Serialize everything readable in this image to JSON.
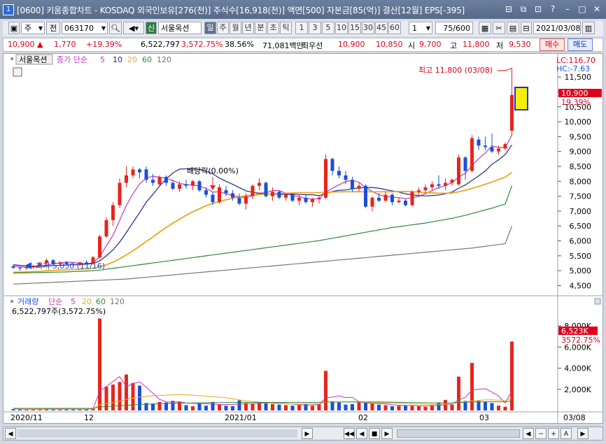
{
  "window": {
    "title": "[0600] 키움종합차트 - KOSDAQ 외국인보유[276(천)] 주식수[16,918(천)] 액면[500] 자본금[85(억)] 결산[12월] EPS[-395]",
    "app_icon": "1",
    "buttons": [
      "restore-icon",
      "duplicate-icon",
      "lock-icon",
      "help-icon",
      "minimize-icon",
      "maximize-icon",
      "close-icon"
    ]
  },
  "toolbar": {
    "market": "주",
    "prev_label": "전",
    "stock_code": "063170",
    "stock_name": "서울옥션",
    "sin_label": "신",
    "periods": [
      "일",
      "주",
      "월",
      "년",
      "분",
      "초",
      "틱"
    ],
    "active_period": "일",
    "minutes": [
      "1",
      "3",
      "5",
      "10",
      "15",
      "30",
      "45",
      "60"
    ],
    "step_value": "1",
    "count": "75/600",
    "date": "2021/03/08"
  },
  "quote": {
    "price": "10,900",
    "change_arrow": "▲",
    "change": "1,770",
    "change_pct": "+19.39%",
    "volume": "6,522,797",
    "volume_pct": "3,572.75%",
    "turnover_pct": "38.56%",
    "amount": "71,081백만",
    "best_label": "최우선",
    "ask": "10,900",
    "bid": "10,850",
    "open_label": "시",
    "open": "9,700",
    "high_label": "고",
    "high": "11,800",
    "low_label": "저",
    "low": "9,530",
    "buy_label": "매수",
    "sell_label": "매도"
  },
  "price_panel": {
    "stock_label": "서울옥션",
    "ma_label": "종가 단순",
    "ma_periods": [
      "5",
      "10",
      "20",
      "60",
      "120"
    ],
    "lc_label": "LC:116.70",
    "hc_label": "HC:-7.63",
    "last_price_label": "10,900",
    "last_pct_label": "19.39%",
    "high_annotation": "최고 11,800 (03/08)",
    "low_annotation": "최저 5,030 (11/16)",
    "dividend_annotation": "배당락(0.00%)"
  },
  "volume_panel": {
    "label": "거래량",
    "ma_label": "단순",
    "ma_periods": [
      "5",
      "20",
      "60",
      "120"
    ],
    "value_text": "6,522,797주(3,572.75%)",
    "last_label": "6,523K",
    "last_pct": "3572.75%"
  },
  "x_axis": {
    "labels": [
      "2020/11",
      "12",
      "2021/01",
      "02",
      "03"
    ],
    "right_label": "03/08"
  },
  "colors": {
    "up": "#e8251b",
    "down": "#1a4fd8",
    "ma5": "#c436c4",
    "ma10": "#1d2a8a",
    "ma20": "#f0a51c",
    "ma60": "#2a8a3a",
    "ma120": "#777777"
  },
  "chart_data": {
    "type": "candlestick",
    "y_ticks": [
      4500,
      5000,
      5500,
      6000,
      6500,
      7000,
      7500,
      8000,
      8500,
      9000,
      9500,
      10000,
      10500,
      11000,
      11500
    ],
    "volume_ticks": [
      "2,000K",
      "4,000K",
      "6,000K",
      "8,000K"
    ],
    "candles": [
      {
        "o": 5150,
        "h": 5200,
        "l": 5050,
        "c": 5100
      },
      {
        "o": 5100,
        "h": 5150,
        "l": 5000,
        "c": 5080
      },
      {
        "o": 5080,
        "h": 5150,
        "l": 5030,
        "c": 5120
      },
      {
        "o": 5120,
        "h": 5200,
        "l": 5070,
        "c": 5160
      },
      {
        "o": 5160,
        "h": 5300,
        "l": 5100,
        "c": 5250
      },
      {
        "o": 5250,
        "h": 5400,
        "l": 5200,
        "c": 5350
      },
      {
        "o": 5350,
        "h": 5400,
        "l": 5200,
        "c": 5230
      },
      {
        "o": 5230,
        "h": 5320,
        "l": 5180,
        "c": 5280
      },
      {
        "o": 5280,
        "h": 5320,
        "l": 5180,
        "c": 5220
      },
      {
        "o": 5220,
        "h": 5280,
        "l": 5150,
        "c": 5200
      },
      {
        "o": 5200,
        "h": 5300,
        "l": 5150,
        "c": 5280
      },
      {
        "o": 5280,
        "h": 5350,
        "l": 5200,
        "c": 5250
      },
      {
        "o": 5250,
        "h": 5500,
        "l": 5200,
        "c": 5450
      },
      {
        "o": 5450,
        "h": 6200,
        "l": 5400,
        "c": 6150
      },
      {
        "o": 6150,
        "h": 6800,
        "l": 6100,
        "c": 6700
      },
      {
        "o": 6700,
        "h": 7300,
        "l": 6500,
        "c": 7200
      },
      {
        "o": 7200,
        "h": 8100,
        "l": 7100,
        "c": 7950
      },
      {
        "o": 7950,
        "h": 8500,
        "l": 7800,
        "c": 8200
      },
      {
        "o": 8200,
        "h": 8500,
        "l": 8100,
        "c": 8400
      },
      {
        "o": 8400,
        "h": 8450,
        "l": 8100,
        "c": 8300
      },
      {
        "o": 8400,
        "h": 8500,
        "l": 7950,
        "c": 8050
      },
      {
        "o": 8050,
        "h": 8250,
        "l": 7850,
        "c": 7950
      },
      {
        "o": 7900,
        "h": 8200,
        "l": 7850,
        "c": 8150
      },
      {
        "o": 8150,
        "h": 8200,
        "l": 7850,
        "c": 7950
      },
      {
        "o": 7950,
        "h": 8050,
        "l": 7700,
        "c": 7750
      },
      {
        "o": 7750,
        "h": 8000,
        "l": 7650,
        "c": 7900
      },
      {
        "o": 7900,
        "h": 8050,
        "l": 7750,
        "c": 7850
      },
      {
        "o": 7850,
        "h": 8050,
        "l": 7700,
        "c": 8000
      },
      {
        "o": 8000,
        "h": 8050,
        "l": 7650,
        "c": 7700
      },
      {
        "o": 7700,
        "h": 7800,
        "l": 7450,
        "c": 7550
      },
      {
        "o": 7550,
        "h": 7650,
        "l": 7200,
        "c": 7300
      },
      {
        "o": 7300,
        "h": 7900,
        "l": 7250,
        "c": 7800
      },
      {
        "o": 7700,
        "h": 7850,
        "l": 7500,
        "c": 7600
      },
      {
        "o": 7600,
        "h": 7700,
        "l": 7350,
        "c": 7450
      },
      {
        "o": 7450,
        "h": 7600,
        "l": 7200,
        "c": 7250
      },
      {
        "o": 7250,
        "h": 7600,
        "l": 7050,
        "c": 7500
      },
      {
        "o": 7500,
        "h": 7900,
        "l": 7400,
        "c": 7850
      },
      {
        "o": 7850,
        "h": 8100,
        "l": 7700,
        "c": 7950
      },
      {
        "o": 7950,
        "h": 8000,
        "l": 7450,
        "c": 7500
      },
      {
        "o": 7500,
        "h": 7800,
        "l": 7350,
        "c": 7650
      },
      {
        "o": 7650,
        "h": 7700,
        "l": 7400,
        "c": 7450
      },
      {
        "o": 7450,
        "h": 7600,
        "l": 7350,
        "c": 7550
      },
      {
        "o": 7550,
        "h": 7600,
        "l": 7300,
        "c": 7350
      },
      {
        "o": 7350,
        "h": 7550,
        "l": 7200,
        "c": 7450
      },
      {
        "o": 7450,
        "h": 7550,
        "l": 7250,
        "c": 7300
      },
      {
        "o": 7300,
        "h": 7450,
        "l": 7150,
        "c": 7400
      },
      {
        "o": 7400,
        "h": 7500,
        "l": 7250,
        "c": 7450
      },
      {
        "o": 7450,
        "h": 8900,
        "l": 7400,
        "c": 8750
      },
      {
        "o": 8750,
        "h": 8800,
        "l": 8200,
        "c": 8350
      },
      {
        "o": 8350,
        "h": 8500,
        "l": 8100,
        "c": 8200
      },
      {
        "o": 8200,
        "h": 8350,
        "l": 7900,
        "c": 8050
      },
      {
        "o": 8050,
        "h": 8150,
        "l": 7650,
        "c": 7750
      },
      {
        "o": 7750,
        "h": 7950,
        "l": 7650,
        "c": 7850
      },
      {
        "o": 7850,
        "h": 7900,
        "l": 7100,
        "c": 7150
      },
      {
        "o": 7150,
        "h": 7500,
        "l": 7000,
        "c": 7450
      },
      {
        "o": 7450,
        "h": 7600,
        "l": 7300,
        "c": 7350
      },
      {
        "o": 7350,
        "h": 7650,
        "l": 7300,
        "c": 7550
      },
      {
        "o": 7550,
        "h": 7600,
        "l": 7200,
        "c": 7300
      },
      {
        "o": 7300,
        "h": 7450,
        "l": 7250,
        "c": 7350
      },
      {
        "o": 7350,
        "h": 7400,
        "l": 7150,
        "c": 7200
      },
      {
        "o": 7200,
        "h": 7700,
        "l": 7150,
        "c": 7650
      },
      {
        "o": 7650,
        "h": 7800,
        "l": 7550,
        "c": 7700
      },
      {
        "o": 7700,
        "h": 7900,
        "l": 7600,
        "c": 7800
      },
      {
        "o": 7800,
        "h": 8000,
        "l": 7700,
        "c": 7900
      },
      {
        "o": 7900,
        "h": 8200,
        "l": 7750,
        "c": 7850
      },
      {
        "o": 7850,
        "h": 8100,
        "l": 7700,
        "c": 7950
      },
      {
        "o": 7950,
        "h": 8100,
        "l": 7850,
        "c": 8050
      },
      {
        "o": 7900,
        "h": 8900,
        "l": 7850,
        "c": 8800
      },
      {
        "o": 8800,
        "h": 8850,
        "l": 8050,
        "c": 8350
      },
      {
        "o": 8350,
        "h": 9550,
        "l": 8300,
        "c": 9450
      },
      {
        "o": 9400,
        "h": 9500,
        "l": 9050,
        "c": 9200
      },
      {
        "o": 9200,
        "h": 9500,
        "l": 9050,
        "c": 9150
      },
      {
        "o": 9150,
        "h": 9600,
        "l": 8950,
        "c": 9000
      },
      {
        "o": 9000,
        "h": 9200,
        "l": 8900,
        "c": 9100
      },
      {
        "o": 9100,
        "h": 9300,
        "l": 9050,
        "c": 9250
      },
      {
        "o": 9700,
        "h": 11800,
        "l": 9530,
        "c": 10900
      }
    ],
    "volumes": [
      130,
      110,
      95,
      100,
      120,
      150,
      140,
      105,
      110,
      100,
      95,
      130,
      150,
      8700,
      2250,
      2450,
      2700,
      3400,
      2600,
      2350,
      700,
      650,
      800,
      750,
      900,
      850,
      500,
      400,
      650,
      450,
      800,
      600,
      450,
      400,
      950,
      700,
      650,
      800,
      750,
      600,
      550,
      500,
      450,
      500,
      600,
      450,
      600,
      3750,
      850,
      750,
      550,
      600,
      800,
      700,
      650,
      550,
      500,
      400,
      450,
      500,
      450,
      400,
      350,
      500,
      700,
      1000,
      550,
      3200,
      900,
      4500,
      900,
      800,
      700,
      450,
      350,
      6523
    ],
    "ma_values": {
      "ma5": [
        5150,
        5130,
        5110,
        5120,
        5150,
        5190,
        5230,
        5260,
        5290,
        5280,
        5240,
        5230,
        5270,
        5470,
        5840,
        6190,
        6690,
        7190,
        7580,
        7910,
        8110,
        8170,
        8140,
        8100,
        8030,
        7930,
        7890,
        7880,
        7840,
        7760,
        7640,
        7650,
        7580,
        7530,
        7480,
        7450,
        7520,
        7600,
        7620,
        7690,
        7690,
        7600,
        7520,
        7490,
        7420,
        7400,
        7420,
        7630,
        7770,
        7880,
        7990,
        8040,
        7970,
        7790,
        7660,
        7550,
        7490,
        7470,
        7450,
        7420,
        7450,
        7500,
        7580,
        7690,
        7790,
        7860,
        7960,
        8140,
        8270,
        8530,
        8760,
        8950,
        9190,
        9140,
        9140,
        9550
      ],
      "ma10": [
        5200,
        5180,
        5160,
        5150,
        5150,
        5160,
        5170,
        5180,
        5190,
        5200,
        5210,
        5220,
        5240,
        5330,
        5500,
        5700,
        5960,
        6280,
        6620,
        6950,
        7300,
        7560,
        7840,
        8080,
        8280,
        8410,
        8420,
        8420,
        8400,
        8340,
        8250,
        8110,
        8000,
        7900,
        7790,
        7680,
        7630,
        7600,
        7570,
        7570,
        7560,
        7560,
        7570,
        7560,
        7550,
        7550,
        7520,
        7590,
        7660,
        7700,
        7710,
        7750,
        7780,
        7790,
        7790,
        7770,
        7720,
        7680,
        7640,
        7580,
        7550,
        7520,
        7510,
        7520,
        7540,
        7580,
        7640,
        7770,
        7880,
        8030,
        8180,
        8350,
        8570,
        8720,
        8900,
        9220
      ],
      "ma20": [
        4950,
        4950,
        4960,
        4970,
        4980,
        5000,
        5010,
        5020,
        5030,
        5040,
        5050,
        5060,
        5080,
        5130,
        5200,
        5290,
        5400,
        5530,
        5670,
        5820,
        5980,
        6130,
        6300,
        6450,
        6600,
        6730,
        6860,
        6980,
        7080,
        7180,
        7260,
        7320,
        7380,
        7430,
        7480,
        7520,
        7540,
        7560,
        7570,
        7580,
        7590,
        7600,
        7610,
        7620,
        7620,
        7620,
        7620,
        7630,
        7640,
        7650,
        7650,
        7650,
        7650,
        7650,
        7650,
        7650,
        7650,
        7650,
        7660,
        7660,
        7650,
        7640,
        7620,
        7610,
        7600,
        7600,
        7610,
        7650,
        7700,
        7760,
        7830,
        7900,
        7980,
        8060,
        8140,
        8300
      ],
      "ma60": [
        4920,
        4925,
        4930,
        4935,
        4940,
        4945,
        4950,
        4955,
        4960,
        4970,
        4980,
        4990,
        5000,
        5020,
        5050,
        5080,
        5110,
        5140,
        5170,
        5200,
        5230,
        5260,
        5290,
        5320,
        5350,
        5380,
        5410,
        5440,
        5470,
        5500,
        5530,
        5560,
        5590,
        5620,
        5650,
        5680,
        5710,
        5740,
        5770,
        5800,
        5830,
        5860,
        5890,
        5920,
        5950,
        5980,
        6010,
        6050,
        6090,
        6130,
        6170,
        6210,
        6250,
        6290,
        6330,
        6370,
        6410,
        6450,
        6480,
        6510,
        6540,
        6570,
        6600,
        6640,
        6680,
        6720,
        6760,
        6810,
        6860,
        6920,
        6980,
        7040,
        7100,
        7170,
        7240,
        7850
      ],
      "ma120": [
        4550,
        4560,
        4570,
        4580,
        4590,
        4600,
        4610,
        4620,
        4630,
        4640,
        4650,
        4660,
        4670,
        4680,
        4690,
        4700,
        4710,
        4720,
        4740,
        4760,
        4780,
        4800,
        4820,
        4840,
        4860,
        4880,
        4900,
        4920,
        4940,
        4960,
        4980,
        5000,
        5020,
        5040,
        5060,
        5080,
        5100,
        5120,
        5140,
        5160,
        5180,
        5200,
        5220,
        5240,
        5260,
        5280,
        5300,
        5320,
        5340,
        5360,
        5380,
        5400,
        5420,
        5440,
        5460,
        5480,
        5500,
        5520,
        5540,
        5560,
        5580,
        5600,
        5620,
        5640,
        5660,
        5680,
        5700,
        5720,
        5740,
        5760,
        5790,
        5820,
        5850,
        5880,
        5910,
        6500
      ]
    },
    "vol_ma": {
      "ma5": [
        120,
        115,
        110,
        112,
        115,
        118,
        120,
        122,
        125,
        118,
        115,
        118,
        125,
        1850,
        2250,
        2750,
        3210,
        2250,
        2540,
        2700,
        2210,
        1620,
        1050,
        810,
        780,
        830,
        700,
        680,
        650,
        630,
        600,
        560,
        560,
        570,
        600,
        620,
        640,
        680,
        700,
        720,
        680,
        650,
        590,
        540,
        510,
        520,
        560,
        1190,
        1260,
        1380,
        1220,
        1240,
        810,
        710,
        660,
        650,
        620,
        540,
        500,
        470,
        460,
        440,
        430,
        440,
        480,
        530,
        600,
        1000,
        1230,
        1950,
        2000,
        2060,
        1730,
        1370,
        700,
        1860
      ],
      "ma20": [
        120,
        118,
        117,
        116,
        116,
        117,
        118,
        118,
        119,
        118,
        118,
        119,
        120,
        550,
        650,
        750,
        880,
        1050,
        1150,
        1250,
        1350,
        1380,
        1420,
        1450,
        1480,
        1500,
        1480,
        1450,
        1400,
        1350,
        1300,
        1250,
        1200,
        1100,
        1000,
        900,
        850,
        780,
        720,
        680,
        650,
        620,
        600,
        600,
        610,
        620,
        620,
        780,
        790,
        800,
        800,
        810,
        790,
        770,
        750,
        730,
        720,
        700,
        680,
        650,
        620,
        600,
        580,
        570,
        580,
        600,
        620,
        800,
        820,
        900,
        950,
        1000,
        1000,
        980,
        950,
        1200
      ],
      "ma60": [
        200,
        200,
        200,
        200,
        200,
        200,
        200,
        200,
        200,
        200,
        200,
        200,
        200,
        330,
        360,
        400,
        440,
        490,
        530,
        570,
        590,
        610,
        630,
        650,
        670,
        690,
        700,
        710,
        720,
        730,
        740,
        745,
        750,
        755,
        760,
        760,
        760,
        760,
        760,
        760,
        760,
        760,
        760,
        760,
        760,
        760,
        760,
        800,
        800,
        800,
        800,
        800,
        800,
        800,
        800,
        800,
        790,
        780,
        770,
        760,
        750,
        740,
        730,
        720,
        720,
        720,
        720,
        760,
        770,
        800,
        810,
        820,
        820,
        820,
        820,
        900
      ]
    }
  }
}
